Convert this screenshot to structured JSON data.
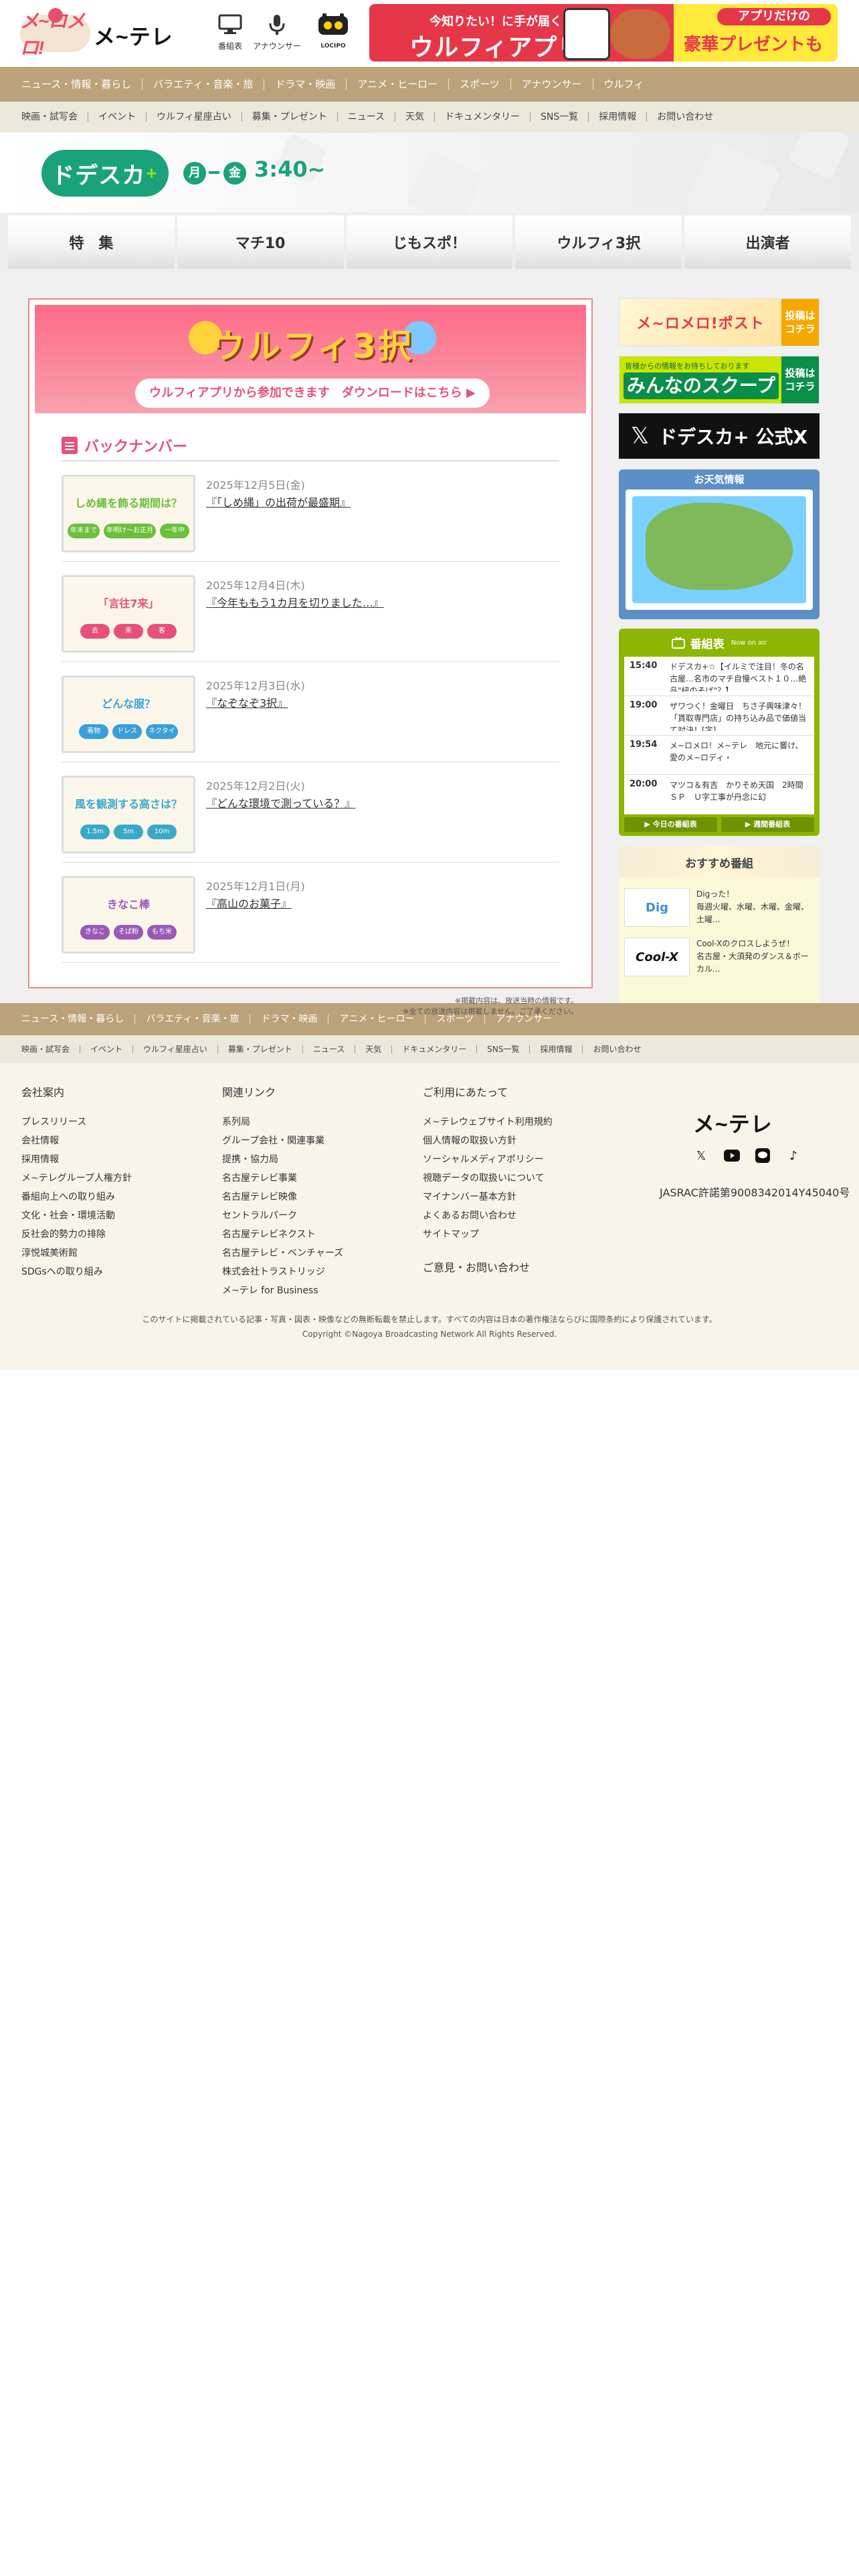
{
  "header": {
    "logo_meromero": "メ~ロメロ!",
    "logo_mtele": "メ~テレ",
    "icons": [
      {
        "label": "番組表",
        "icon": "tv-guide-icon"
      },
      {
        "label": "アナウンサー",
        "icon": "microphone-icon"
      },
      {
        "label": "LOCIPO",
        "icon": "locipo-icon"
      }
    ],
    "banner": {
      "line1": "今知りたい！に手が届く",
      "line2": "ウルフィアプリ",
      "right1": "アプリだけの",
      "right2": "豪華プレゼントも"
    }
  },
  "nav_primary": [
    "ニュース・情報・暮らし",
    "バラエティ・音楽・旅",
    "ドラマ・映画",
    "アニメ・ヒーロー",
    "スポーツ",
    "アナウンサー",
    "ウルフィ"
  ],
  "nav_secondary": [
    "映画・試写会",
    "イベント",
    "ウルフィ星座占い",
    "募集・プレゼント",
    "ニュース",
    "天気",
    "ドキュメンタリー",
    "SNS一覧",
    "採用情報",
    "お問い合わせ"
  ],
  "program": {
    "logo": "ドデスカ",
    "logo_plus": "+",
    "day_from": "月",
    "day_to": "金",
    "time": "3:40~"
  },
  "tabs": [
    "特　集",
    "マチ10",
    "じもスポ！",
    "ウルフィ3択",
    "出演者"
  ],
  "wolfie_banner": {
    "title": "ウルフィ3択",
    "button": "ウルフィアプリから参加できます　ダウンロードはこちら ▶"
  },
  "backnumber": {
    "heading": "バックナンバー",
    "items": [
      {
        "date": "2025年12月5日(金)",
        "title": "『「しめ縄」の出荷が最盛期』",
        "thumb": "しめ縄を飾る期間は？",
        "tags": [
          "年末まで",
          "年明け～お正月",
          "一年中"
        ],
        "color": "#6bbf3a"
      },
      {
        "date": "2025年12月4日(木)",
        "title": "『今年ももう1カ月を切りました…』",
        "thumb": "「言往7来」",
        "tags": [
          "去",
          "来",
          "客"
        ],
        "color": "#e6507a"
      },
      {
        "date": "2025年12月3日(水)",
        "title": "『なぞなぞ3択』",
        "thumb": "どんな服？",
        "tags": [
          "着物",
          "ドレス",
          "ネクタイ"
        ],
        "color": "#3a9fd8"
      },
      {
        "date": "2025年12月2日(火)",
        "title": "『どんな環境で測っている？』",
        "thumb": "風を観測する高さは？",
        "tags": [
          "1.5m",
          "5m",
          "10m"
        ],
        "color": "#3aa8c8"
      },
      {
        "date": "2025年12月1日(月)",
        "title": "『高山のお菓子』",
        "thumb": "きなこ棒",
        "tags": [
          "きなこ",
          "そば粉",
          "もち米"
        ],
        "color": "#9b59b6"
      }
    ]
  },
  "notes": [
    "※掲載内容は、放送当時の情報です。",
    "※全ての放送内容は掲載しません。ご了承ください。"
  ],
  "sidebar": {
    "meromero_post": {
      "label": "メ~ロメロ!ポスト",
      "cta": "投稿はコチラ"
    },
    "scoop": {
      "small": "皆様からの情報をお待ちしております",
      "label": "みんなのスクープ",
      "cta": "投稿はコチラ"
    },
    "x_account": {
      "label": "ドデスカ+ 公式X"
    },
    "weather": {
      "heading": "お天気情報"
    },
    "tv_schedule": {
      "heading": "番組表",
      "sub": "Now on air",
      "rows": [
        {
          "time": "15:40",
          "program": "ドデスカ+☆【イルミで注目！冬の名古屋…名市のマチ自慢ベスト１０…絶品\"紐のそば\"？】"
        },
        {
          "time": "19:00",
          "program": "ザワつく！金曜日　ちさ子興味津々！「貰取専門店」の持ち込み品で価値当て対決！[字]"
        },
        {
          "time": "19:54",
          "program": "メ~ロメロ！メ~テレ　地元に響け、愛のメ~ロディ・"
        },
        {
          "time": "20:00",
          "program": "マツコ＆有吉　かりそめ天国　2時間ＳＰ　Ｕ字工事が丹念に幻"
        }
      ],
      "btn_today": "▶ 今日の番組表",
      "btn_week": "▶ 週間番組表"
    },
    "recommend": {
      "heading": "おすすめ番組",
      "items": [
        {
          "name": "Digった！",
          "desc": "毎週火曜、水曜、木曜、金曜、土曜..."
        },
        {
          "name": "Cool-Xのクロスしようぜ！",
          "desc": "名古屋・大須発のダンス＆ボーカル..."
        }
      ]
    }
  },
  "footer_nav_primary": [
    "ニュース・情報・暮らし",
    "バラエティ・音楽・旅",
    "ドラマ・映画",
    "アニメ・ヒーロー",
    "スポーツ",
    "アナウンサー"
  ],
  "footer_nav_secondary": [
    "映画・試写会",
    "イベント",
    "ウルフィ星座占い",
    "募集・プレゼント",
    "ニュース",
    "天気",
    "ドキュメンタリー",
    "SNS一覧",
    "採用情報",
    "お問い合わせ"
  ],
  "footer": {
    "col1": {
      "title": "会社案内",
      "links": [
        "プレスリリース",
        "会社情報",
        "採用情報",
        "メ~テレグループ人権方針",
        "番組向上への取り組み",
        "文化・社会・環境活動",
        "反社会的勢力の排除",
        "淳悦城美術館",
        "SDGsへの取り組み"
      ]
    },
    "col2": {
      "title": "関連リンク",
      "links": [
        "系列局",
        "グループ会社・関連事業",
        "提携・協力局",
        "名古屋テレビ事業",
        "名古屋テレビ映像",
        "セントラルパーク",
        "名古屋テレビネクスト",
        "名古屋テレビ・ベンチャーズ",
        "株式会社トラストリッジ",
        "メ~テレ for Business"
      ]
    },
    "col3": {
      "title": "ご利用にあたって",
      "links": [
        "メ~テレウェブサイト利用規約",
        "個人情報の取扱い方針",
        "ソーシャルメディアポリシー",
        "視聴データの取扱いについて",
        "マイナンバー基本方針",
        "よくあるお問い合わせ",
        "サイトマップ"
      ],
      "contact": "ご意見・お問い合わせ"
    },
    "logo": "メ~テレ",
    "jasrac": "JASRAC許諾第9008342014Y45040号",
    "copyright1": "このサイトに掲載されている記事・写真・図表・映像などの無断転載を禁止します。すべての内容は日本の著作権法ならびに国際条約により保護されています。",
    "copyright2": "Copyright ©Nagoya Broadcasting Network All Rights Reserved."
  }
}
